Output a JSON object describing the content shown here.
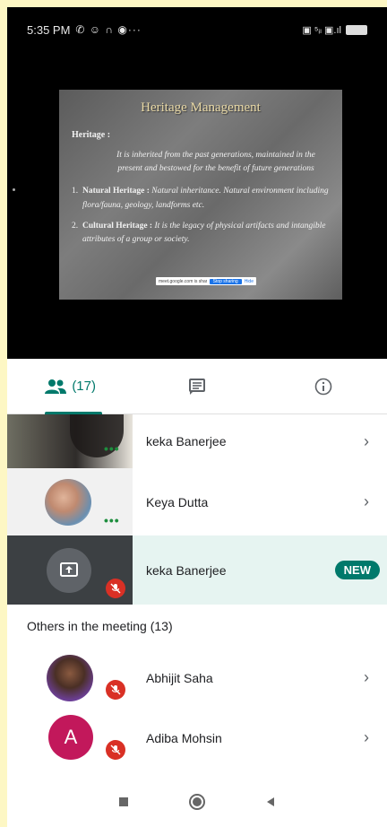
{
  "status_bar": {
    "time": "5:35 PM",
    "notification_icons": "✆ ☺ ∩ ◉···",
    "right_icons": "▣ ⁵ᵢₗ ▣.ıl"
  },
  "slide": {
    "title": "Heritage Management",
    "heading": "Heritage :",
    "definition": "It is inherited from the past generations, maintained in the present and bestowed for the benefit of future generations",
    "items": [
      {
        "num": "1.",
        "bold": "Natural   Heritage :",
        "text": " Natural inheritance. Natural environment including flora/fauna, geology, landforms etc."
      },
      {
        "num": "2.",
        "bold": "Cultural  Heritage :",
        "text": " It is the legacy of physical artifacts and intangible attributes of a group or society."
      }
    ],
    "share_bar": {
      "text": "meet.google.com is sharing your screen",
      "stop": "Stop sharing",
      "hide": "Hide"
    }
  },
  "tabs": {
    "people_count": "(17)"
  },
  "participants": [
    {
      "name": "keka Banerjee"
    },
    {
      "name": "Keya Dutta"
    },
    {
      "name": "keka Banerjee",
      "badge": "NEW"
    }
  ],
  "others": {
    "label": "Others in the meeting (13)",
    "items": [
      {
        "name": "Abhijit Saha"
      },
      {
        "name": "Adiba Mohsin",
        "initial": "A"
      }
    ]
  },
  "colors": {
    "accent": "#00796b",
    "mute": "#d93025",
    "avatar_a": "#c2185b"
  }
}
